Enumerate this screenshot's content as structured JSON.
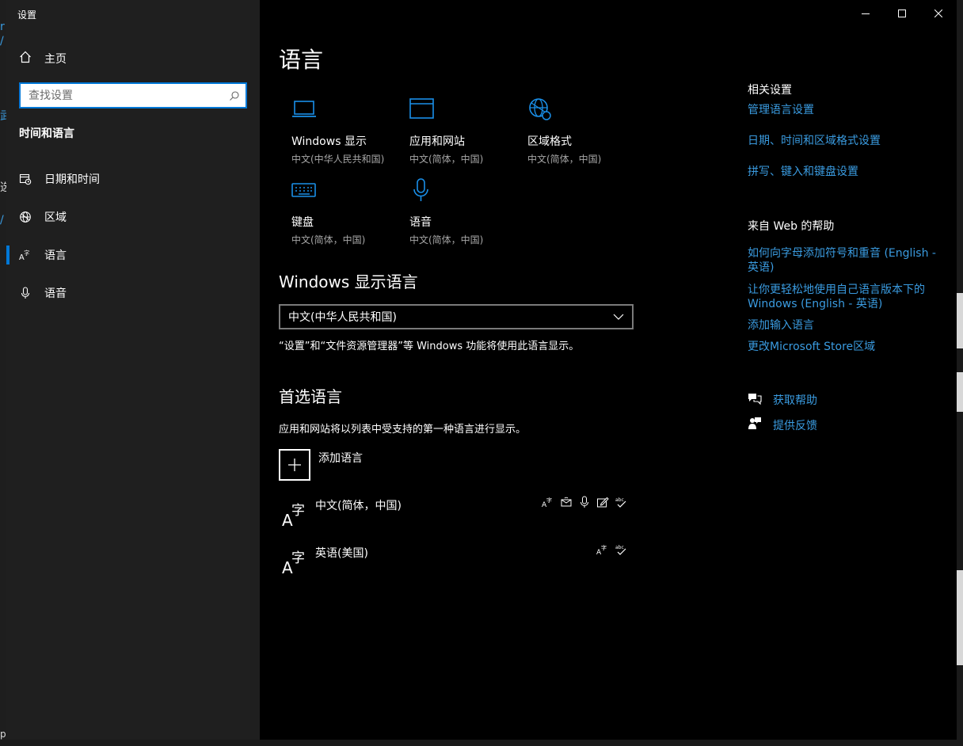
{
  "window": {
    "title": "设置"
  },
  "sidebar": {
    "home_label": "主页",
    "search_placeholder": "查找设置",
    "section_title": "时间和语言",
    "items": [
      {
        "label": "日期和时间",
        "icon": "calendar-clock-icon",
        "active": false
      },
      {
        "label": "区域",
        "icon": "globe-region-icon",
        "active": false
      },
      {
        "label": "语言",
        "icon": "language-icon",
        "active": true
      },
      {
        "label": "语音",
        "icon": "microphone-icon",
        "active": false
      }
    ]
  },
  "main": {
    "title": "语言",
    "tiles": [
      {
        "name": "Windows 显示",
        "sub": "中文(中华人民共和国)",
        "icon": "laptop-icon"
      },
      {
        "name": "应用和网站",
        "sub": "中文(简体，中国)",
        "icon": "browser-window-icon"
      },
      {
        "name": "区域格式",
        "sub": "中文(简体，中国)",
        "icon": "region-format-icon"
      },
      {
        "name": "键盘",
        "sub": "中文(简体，中国)",
        "icon": "keyboard-icon"
      },
      {
        "name": "语音",
        "sub": "中文(简体，中国)",
        "icon": "microphone-icon"
      }
    ],
    "display_lang_heading": "Windows 显示语言",
    "display_lang_value": "中文(中华人民共和国)",
    "display_lang_desc": "“设置”和“文件资源管理器”等 Windows 功能将使用此语言显示。",
    "preferred_heading": "首选语言",
    "preferred_desc": "应用和网站将以列表中受支持的第一种语言进行显示。",
    "add_lang_label": "添加语言",
    "languages": [
      {
        "name": "中文(简体，中国)",
        "features": [
          "display-language-icon",
          "text-to-speech-icon",
          "speech-recognition-icon",
          "handwriting-icon",
          "spell-check-icon"
        ]
      },
      {
        "name": "英语(美国)",
        "features": [
          "display-language-icon",
          "spell-check-icon"
        ]
      }
    ]
  },
  "aside": {
    "related_heading": "相关设置",
    "related_links": [
      "管理语言设置",
      "日期、时间和区域格式设置",
      "拼写、键入和键盘设置"
    ],
    "web_help_heading": "来自 Web 的帮助",
    "web_links": [
      "如何向字母添加符号和重音 (English - 英语)",
      "让你更轻松地使用自己语言版本下的 Windows (English - 英语)",
      "添加输入语言",
      "更改Microsoft Store区域"
    ],
    "get_help": "获取帮助",
    "feedback": "提供反馈"
  },
  "colors": {
    "accent": "#0078d7",
    "link": "#3a9be0",
    "sidebar_bg": "#1f1f1f",
    "window_bg": "#000000"
  }
}
